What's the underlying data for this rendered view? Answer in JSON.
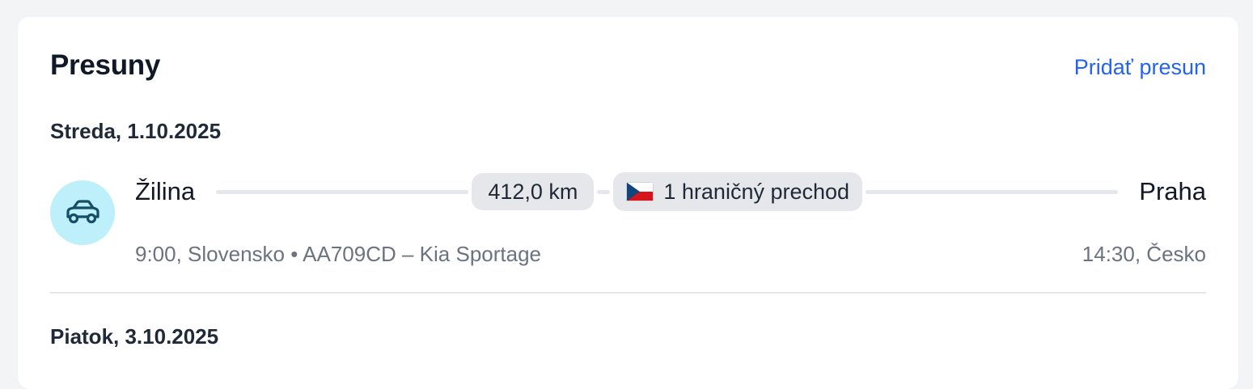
{
  "section": {
    "title": "Presuny",
    "add_label": "Pridať presun"
  },
  "days": [
    {
      "heading": "Streda, 1.10.2025",
      "trips": [
        {
          "icon": "car-icon",
          "from_city": "Žilina",
          "to_city": "Praha",
          "distance": "412,0 km",
          "border_crossing": "1 hraničný prechod",
          "border_flag": "czech-flag-icon",
          "departure": "9:00, Slovensko",
          "separator": "•",
          "vehicle": "AA709CD – Kia Sportage",
          "arrival": "14:30, Česko"
        }
      ]
    },
    {
      "heading": "Piatok, 3.10.2025"
    }
  ],
  "colors": {
    "accent": "#2563eb",
    "icon_bg": "#bdf0fa",
    "icon_fg": "#164e63",
    "pill_bg": "#e5e7eb",
    "muted_text": "#6b7280"
  }
}
